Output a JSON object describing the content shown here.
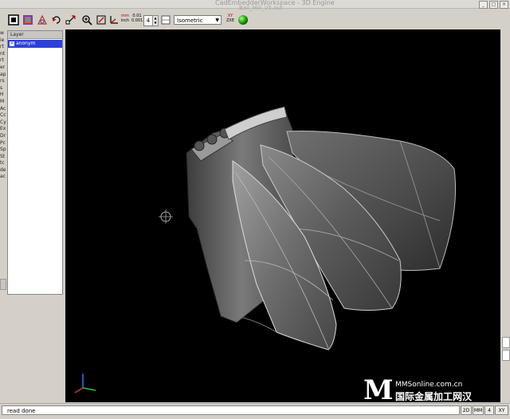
{
  "window": {
    "title": "CadEmbedderWorkspace - 3D Engine",
    "subtitle": "Ball_Mill_V5.out",
    "buttons": [
      "_",
      "□",
      "×"
    ]
  },
  "toolbar": {
    "unit_top": "mm",
    "unit_bottom": "inch",
    "tol_top": "0.01",
    "tol_bottom": "0.001",
    "decimals": "4",
    "view": "Isometric",
    "coord_top": "XY",
    "coord_bottom": "ZXE"
  },
  "left_strip": [
    "w",
    "ie",
    "rt",
    "nt",
    "rt",
    "",
    "er",
    "ap",
    "rs",
    "s",
    "H",
    "M",
    "Ac",
    "Cc",
    "Cy",
    "Ex",
    "Dr",
    "Pc",
    "Sp",
    "St",
    "",
    "",
    "",
    "",
    "",
    "tc",
    "de",
    "ac"
  ],
  "layers": {
    "header": "Layer",
    "items": [
      {
        "label": "anonym",
        "visible": true
      }
    ]
  },
  "status": {
    "message": "read done",
    "boxes": [
      "2D",
      "MM",
      "4",
      "XY"
    ]
  },
  "watermark": {
    "letter": "M",
    "url": "MMSonline.com.cn",
    "chinese": "国际金属加工网",
    "city": "汉"
  },
  "colors": {
    "viewport_bg": "#000000",
    "selection": "#2e3fd8",
    "shaded_ball": "#34c01a"
  }
}
